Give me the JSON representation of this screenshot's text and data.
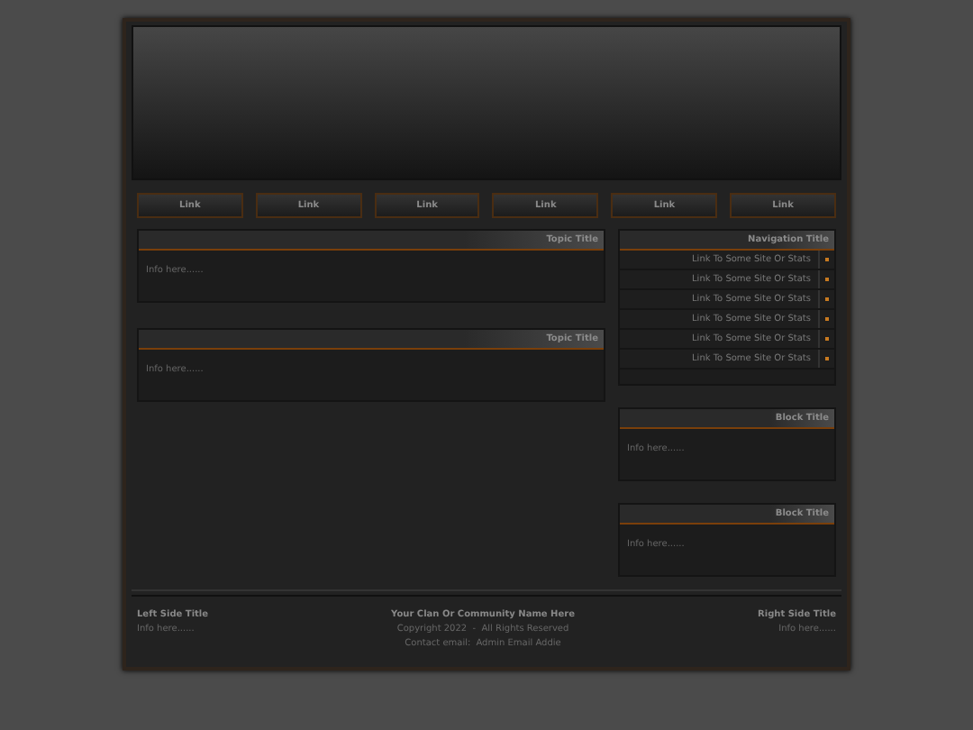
{
  "nav_links": [
    "Link",
    "Link",
    "Link",
    "Link",
    "Link",
    "Link"
  ],
  "topics": [
    {
      "title": "Topic Title",
      "body": "Info here......"
    },
    {
      "title": "Topic Title",
      "body": "Info here......"
    }
  ],
  "navigation": {
    "title": "Navigation Title",
    "links": [
      "Link To Some Site Or Stats",
      "Link To Some Site Or Stats",
      "Link To Some Site Or Stats",
      "Link To Some Site Or Stats",
      "Link To Some Site Or Stats",
      "Link To Some Site Or Stats"
    ]
  },
  "blocks": [
    {
      "title": "Block Title",
      "body": "Info here......"
    },
    {
      "title": "Block Title",
      "body": "Info here......"
    }
  ],
  "footer": {
    "left": {
      "title": "Left Side Title",
      "body": "Info here......"
    },
    "center": {
      "title": "Your Clan Or Community Name Here",
      "copyright": "Copyright 2022  -  All Rights Reserved",
      "contact_label": "Contact email:",
      "contact_link": "Admin Email Addie"
    },
    "right": {
      "title": "Right Side Title",
      "body": "Info here......"
    }
  }
}
